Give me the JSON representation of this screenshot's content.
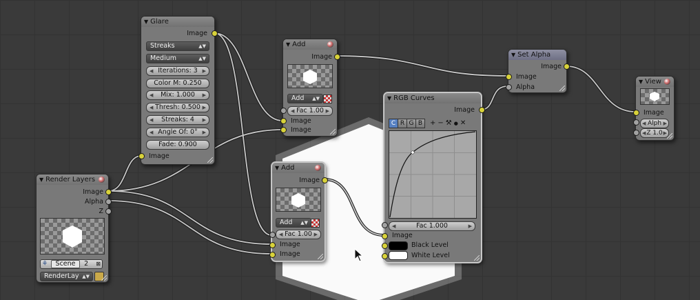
{
  "colors": {
    "socket_image": "#d8d23a",
    "socket_value": "#a2a2a2",
    "wire": "#c8c8c8",
    "node_body": "#797979",
    "black_level": "#000000",
    "white_level": "#ffffff"
  },
  "glare": {
    "title": "Glare",
    "output_image": "Image",
    "type_value": "Streaks",
    "quality_value": "Medium",
    "iterations": "Iterations: 3",
    "color_mod": "Color M: 0.250",
    "mix": "Mix: 1.000",
    "threshold": "Thresh: 0.500",
    "streaks": "Streaks: 4",
    "angle_offset": "Angle Of: 0°",
    "fade": "Fade: 0.900",
    "input_image": "Image"
  },
  "render_layers": {
    "title": "Render Layers",
    "out_image": "Image",
    "out_alpha": "Alpha",
    "out_z": "Z",
    "scene_name": "Scene",
    "scene_users": "2",
    "layer_name": "RenderLay"
  },
  "add_top": {
    "title": "Add",
    "output_image": "Image",
    "blend_mode": "Add",
    "fac": "Fac 1.00",
    "input_image_1": "Image",
    "input_image_2": "Image"
  },
  "add_bottom": {
    "title": "Add",
    "output_image": "Image",
    "blend_mode": "Add",
    "fac": "Fac 1.00",
    "input_image_1": "Image",
    "input_image_2": "Image"
  },
  "rgb_curves": {
    "title": "RGB Curves",
    "output_image": "Image",
    "channel_tabs": [
      "C",
      "R",
      "G",
      "B"
    ],
    "active_channel": "C",
    "tool_icons": [
      "zoom-in-icon",
      "zoom-out-icon",
      "wrench-icon",
      "point-icon",
      "delete-icon"
    ],
    "tool_glyphs": [
      "+",
      "−",
      "⚒",
      "●",
      "✕"
    ],
    "fac": "Fac 1.000",
    "input_image": "Image",
    "black_level": "Black Level",
    "white_level": "White Level"
  },
  "set_alpha": {
    "title": "Set Alpha",
    "output_image": "Image",
    "input_image": "Image",
    "input_alpha": "Alpha"
  },
  "viewer": {
    "title": "View",
    "input_image": "Image",
    "alpha": "Alph",
    "z": "Z 1.0"
  }
}
